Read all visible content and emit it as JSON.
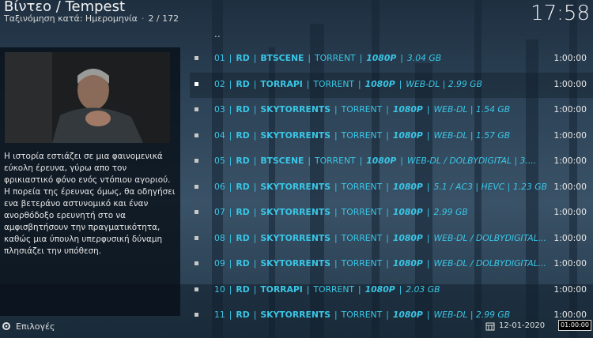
{
  "header": {
    "title": "Βίντεο / Tempest",
    "sort_label": "Ταξινόμηση κατά: Ημερομηνία",
    "position": "2 / 172",
    "clock": "17:58"
  },
  "plot": "Η ιστορία εστιάζει σε μια φαινομενικά εύκολη έρευνα, γύρω απο τον φρικιαστικό φόνο ενός ντόπιου αγοριού. Η πορεία της έρευνας όμως, θα οδηγήσει ενα βετεράνο αστυνομικό και έναν ανορθόδοξο ερευνητή στο να αμφισβητήσουν την πραγματικότητα, καθώς μια ύπουλη υπερφυσική δύναμη πλησιάζει την υπόθεση.",
  "list": {
    "parent": "..",
    "items": [
      {
        "num": "01",
        "src": "RD",
        "tracker": "BTSCENE",
        "type": "TORRENT",
        "res": "1080P",
        "rest": "3.04 GB",
        "dur": "1:00:00"
      },
      {
        "num": "02",
        "src": "RD",
        "tracker": "TORRAPI",
        "type": "TORRENT",
        "res": "1080P",
        "rest": "WEB-DL  |  2.99 GB",
        "dur": "1:00:00"
      },
      {
        "num": "03",
        "src": "RD",
        "tracker": "SKYTORRENTS",
        "type": "TORRENT",
        "res": "1080P",
        "rest": "WEB-DL  |  1.54 GB",
        "dur": "1:00:00"
      },
      {
        "num": "04",
        "src": "RD",
        "tracker": "SKYTORRENTS",
        "type": "TORRENT",
        "res": "1080P",
        "rest": "WEB-DL  |  1.57 GB",
        "dur": "1:00:00"
      },
      {
        "num": "05",
        "src": "RD",
        "tracker": "BTSCENE",
        "type": "TORRENT",
        "res": "1080P",
        "rest": "WEB-DL / DOLBYDIGITAL  |  3....",
        "dur": "1:00:00"
      },
      {
        "num": "06",
        "src": "RD",
        "tracker": "SKYTORRENTS",
        "type": "TORRENT",
        "res": "1080P",
        "rest": "5.1 / AC3  |  HEVC  |  1.23 GB",
        "dur": "1:00:00"
      },
      {
        "num": "07",
        "src": "RD",
        "tracker": "SKYTORRENTS",
        "type": "TORRENT",
        "res": "1080P",
        "rest": "2.99 GB",
        "dur": "1:00:00"
      },
      {
        "num": "08",
        "src": "RD",
        "tracker": "SKYTORRENTS",
        "type": "TORRENT",
        "res": "1080P",
        "rest": "WEB-DL / DOLBYDIGITAL...",
        "dur": "1:00:00"
      },
      {
        "num": "09",
        "src": "RD",
        "tracker": "SKYTORRENTS",
        "type": "TORRENT",
        "res": "1080P",
        "rest": "WEB-DL / DOLBYDIGITAL...",
        "dur": "1:00:00"
      },
      {
        "num": "10",
        "src": "RD",
        "tracker": "TORRAPI",
        "type": "TORRENT",
        "res": "1080P",
        "rest": "2.03 GB",
        "dur": "1:00:00"
      },
      {
        "num": "11",
        "src": "RD",
        "tracker": "SKYTORRENTS",
        "type": "TORRENT",
        "res": "1080P",
        "rest": "WEB-DL  |  2.99 GB",
        "dur": "1:00:00"
      }
    ]
  },
  "footer": {
    "options_label": "Επιλογές",
    "date": "12-01-2020",
    "time_badge": "01:00:00"
  },
  "colors": {
    "accent": "#3ac6e6",
    "panel": "#08101a"
  }
}
